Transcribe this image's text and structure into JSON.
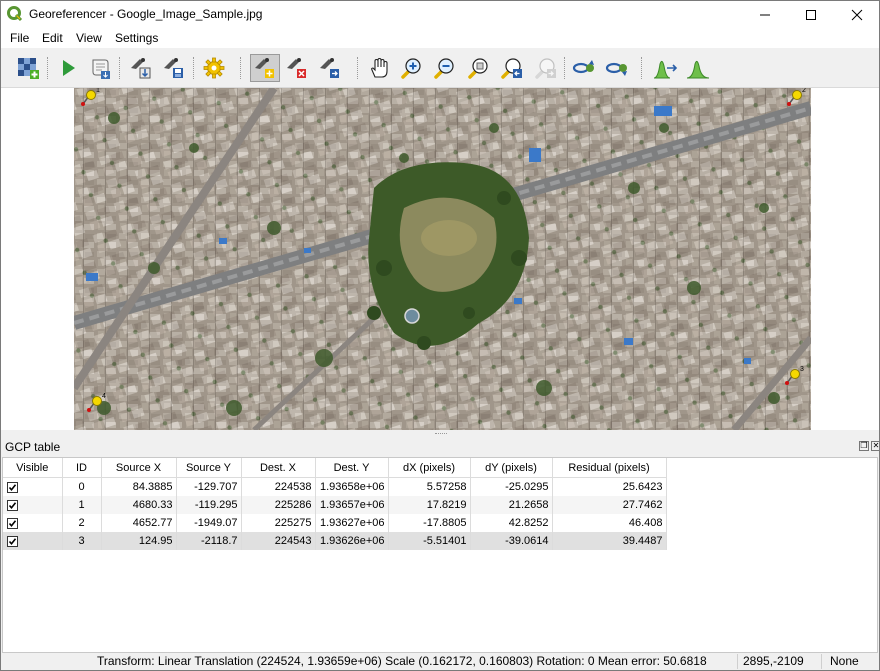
{
  "window": {
    "title": "Georeferencer - Google_Image_Sample.jpg",
    "controls": {
      "minimize": "minimize",
      "maximize": "maximize",
      "close": "close"
    }
  },
  "menu": [
    "File",
    "Edit",
    "View",
    "Settings"
  ],
  "toolbar": {
    "icons": [
      "open-raster-icon",
      "start-georeferencing-icon",
      "generate-gdal-script-icon",
      "load-gcp-points-icon",
      "save-gcp-points-icon",
      "transformation-settings-icon",
      "add-point-icon",
      "delete-point-icon",
      "move-gcp-point-icon",
      "pan-icon",
      "zoom-in-icon",
      "zoom-out-icon",
      "zoom-to-layer-icon",
      "zoom-last-icon",
      "zoom-next-icon",
      "link-georef-to-qgis-icon",
      "link-qgis-to-georef-icon",
      "full-histogram-stretch-icon",
      "local-histogram-stretch-icon"
    ]
  },
  "gcp_markers": [
    "1",
    "2",
    "3",
    "4"
  ],
  "gcp_panel": {
    "title": "GCP table",
    "columns": [
      "Visible",
      "ID",
      "Source X",
      "Source Y",
      "Dest. X",
      "Dest. Y",
      "dX (pixels)",
      "dY (pixels)",
      "Residual (pixels)"
    ],
    "rows": [
      {
        "visible": true,
        "id": "0",
        "source_x": "84.3885",
        "source_y": "-129.707",
        "dest_x": "224538",
        "dest_y": "1.93658e+06",
        "dx": "5.57258",
        "dy": "-25.0295",
        "residual": "25.6423"
      },
      {
        "visible": true,
        "id": "1",
        "source_x": "4680.33",
        "source_y": "-119.295",
        "dest_x": "225286",
        "dest_y": "1.93657e+06",
        "dx": "17.8219",
        "dy": "21.2658",
        "residual": "27.7462"
      },
      {
        "visible": true,
        "id": "2",
        "source_x": "4652.77",
        "source_y": "-1949.07",
        "dest_x": "225275",
        "dest_y": "1.93627e+06",
        "dx": "-17.8805",
        "dy": "42.8252",
        "residual": "46.408"
      },
      {
        "visible": true,
        "id": "3",
        "source_x": "124.95",
        "source_y": "-2118.7",
        "dest_x": "224543",
        "dest_y": "1.93626e+06",
        "dx": "-5.51401",
        "dy": "-39.0614",
        "residual": "39.4487"
      }
    ]
  },
  "statusbar": {
    "transform": "Transform: Linear Translation (224524, 1.93659e+06) Scale (0.162172, 0.160803) Rotation: 0 Mean error: 50.6818",
    "coords": "2895,-2109",
    "crs": "None"
  },
  "colors": {
    "accent_green": "#589632",
    "gcp_marker": "#f5d800",
    "gcp_marker_tip": "#d01010"
  }
}
